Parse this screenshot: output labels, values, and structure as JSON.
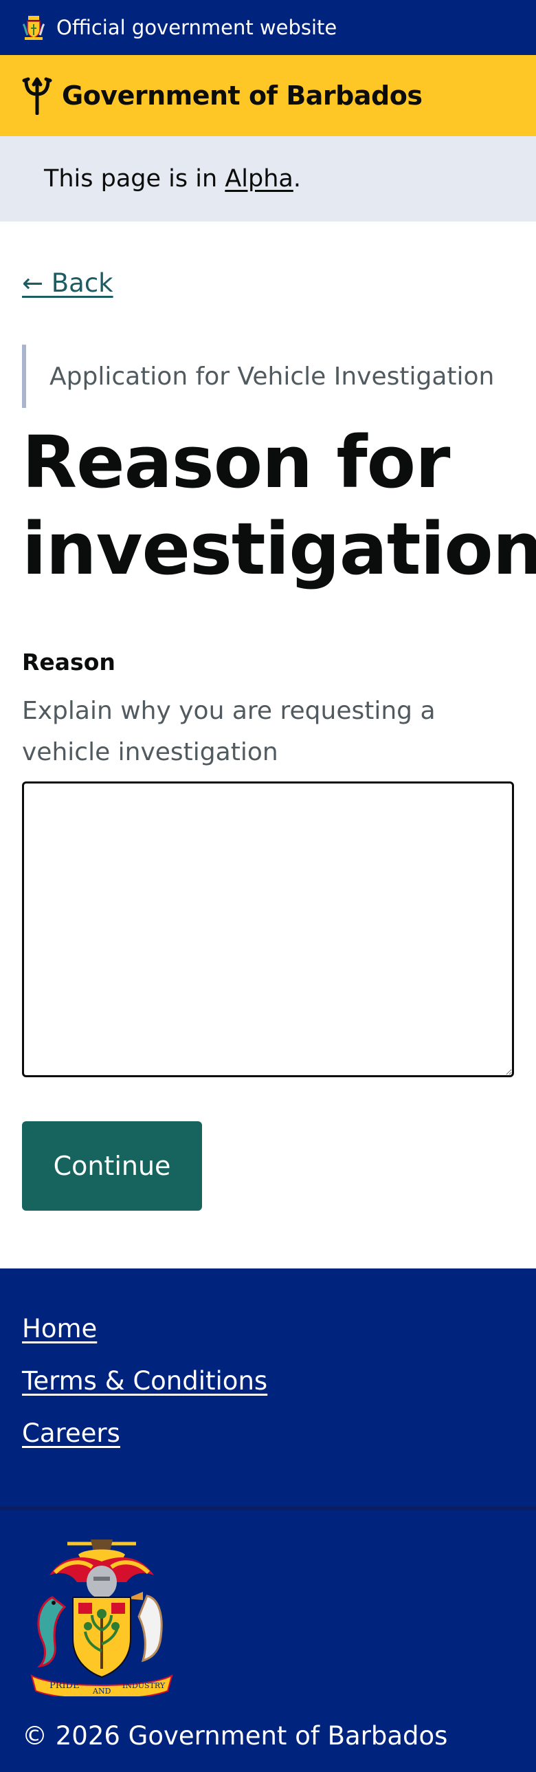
{
  "official_bar": {
    "text": "Official government website"
  },
  "brand": {
    "name": "Government of Barbados"
  },
  "phase": {
    "prefix": "This page is in ",
    "link": "Alpha",
    "suffix": "."
  },
  "back": {
    "label": "← Back"
  },
  "form": {
    "caption": "Application for Vehicle Investigation",
    "title": "Reason for investigation",
    "field_label": "Reason",
    "hint": "Explain why you are requesting a vehicle investigation",
    "value": "",
    "submit_label": "Continue"
  },
  "footer": {
    "links": [
      "Home",
      "Terms & Conditions",
      "Careers"
    ],
    "coat_motto": [
      "PRIDE",
      "AND",
      "INDUSTRY"
    ],
    "copyright": "© 2026 Government of Barbados"
  },
  "colors": {
    "navy": "#00247d",
    "gold": "#ffc726",
    "phase_bg": "#e5e9f2",
    "button": "#17645f",
    "link": "#1b5d63"
  }
}
